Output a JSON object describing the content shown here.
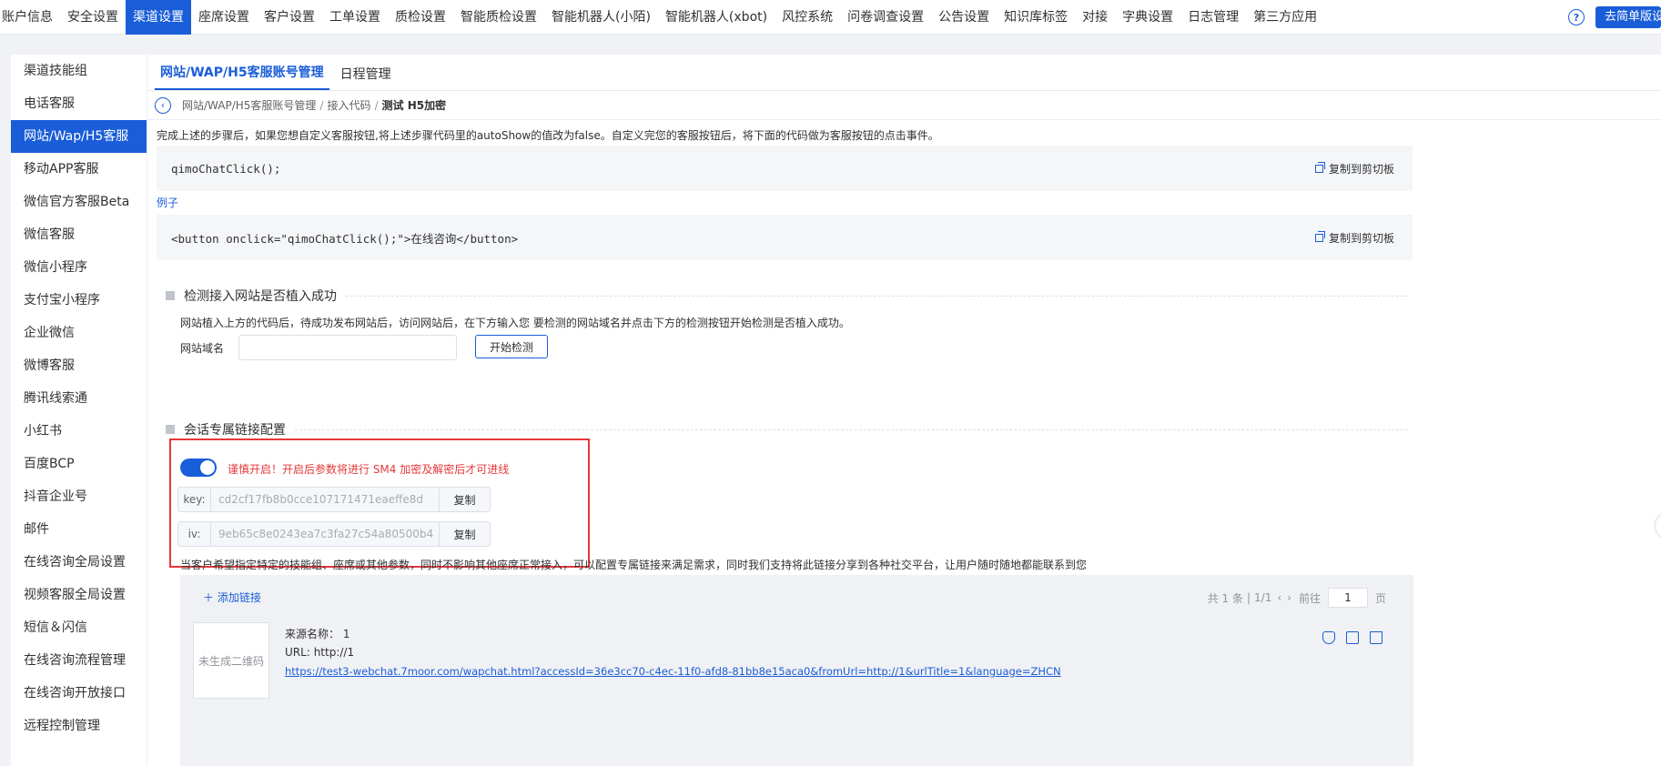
{
  "topnav": {
    "items": [
      "账户信息",
      "安全设置",
      "渠道设置",
      "座席设置",
      "客户设置",
      "工单设置",
      "质检设置",
      "智能质检设置",
      "智能机器人(小陌)",
      "智能机器人(xbot)",
      "风控系统",
      "问卷调查设置",
      "公告设置",
      "知识库标签",
      "对接",
      "字典设置",
      "日志管理",
      "第三方应用"
    ],
    "active_index": 2,
    "help": "?",
    "simple_button": "去简单版设置"
  },
  "sidebar": {
    "items": [
      "渠道技能组",
      "电话客服",
      "网站/Wap/H5客服",
      "移动APP客服",
      "微信官方客服Beta",
      "微信客服",
      "微信小程序",
      "支付宝小程序",
      "企业微信",
      "微博客服",
      "腾讯线索通",
      "小红书",
      "百度BCP",
      "抖音企业号",
      "邮件",
      "在线咨询全局设置",
      "视频客服全局设置",
      "短信＆闪信",
      "在线咨询流程管理",
      "在线咨询开放接口",
      "远程控制管理"
    ],
    "active_index": 2
  },
  "tabs": [
    "网站/WAP/H5客服账号管理",
    "日程管理"
  ],
  "breadcrumb": {
    "items": [
      "网站/WAP/H5客服账号管理",
      "接入代码"
    ],
    "current": "测试 H5加密"
  },
  "content": {
    "intro_text": "完成上述的步骤后，如果您想自定义客服按钮,将上述步骤代码里的autoShow的值改为false。自定义完您的客服按钮后，将下面的代码做为客服按钮的点击事件。",
    "code1": "qimoChatClick();",
    "copy_label": "复制到剪切板",
    "example_label": "例子",
    "code2": "<button onclick=\"qimoChatClick();\">在线咨询</button>",
    "section_detect": {
      "title": "检测接入网站是否植入成功",
      "desc": "网站植入上方的代码后，待成功发布网站后，访问网站后，在下方输入您 要检测的网站域名并点击下方的检测按钮开始检测是否植入成功。",
      "field_label": "网站域名",
      "field_value": "",
      "button": "开始检测"
    },
    "section_link": {
      "title": "会话专属链接配置",
      "toggle_on": true,
      "warning": "谨慎开启！开启后参数将进行 SM4 加密及解密后才可进线",
      "key_label": "key:",
      "key_value": "cd2cf17fb8b0cce107171471eaeffe8d",
      "iv_label": "iv:",
      "iv_value": "9eb65c8e0243ea7c3fa27c54a80500b4",
      "copy_button": "复制",
      "desc": "当客户希望指定特定的技能组、座席或其他参数，同时不影响其他座席正常接入，可以配置专属链接来满足需求，同时我们支持将此链接分享到各种社交平台，让用户随时随地都能联系到您",
      "add_link": "添加链接",
      "pager": {
        "total": "共 1 条",
        "pages": "1/1",
        "prev": "‹",
        "next": "›",
        "goto": "前往",
        "page_value": "1",
        "page_suffix": "页"
      },
      "record": {
        "qr_placeholder": "未生成二维码",
        "source_label": "来源名称：",
        "source_value": "1",
        "url_label": "URL:",
        "url_value": "http://1",
        "full_link": "https://test3-webchat.7moor.com/wapchat.html?accessId=36e3cc70-c4ec-11f0-afd8-81bb8e15aca0&fromUrl=http://1&urlTitle=1&language=ZHCN"
      }
    }
  },
  "colors": {
    "primary": "#1a5dd8",
    "warning_red": "#e5383b"
  },
  "icons": [
    "help-icon",
    "back-icon",
    "copy-icon",
    "plus-icon",
    "shield-icon",
    "edit-icon",
    "delete-icon"
  ]
}
